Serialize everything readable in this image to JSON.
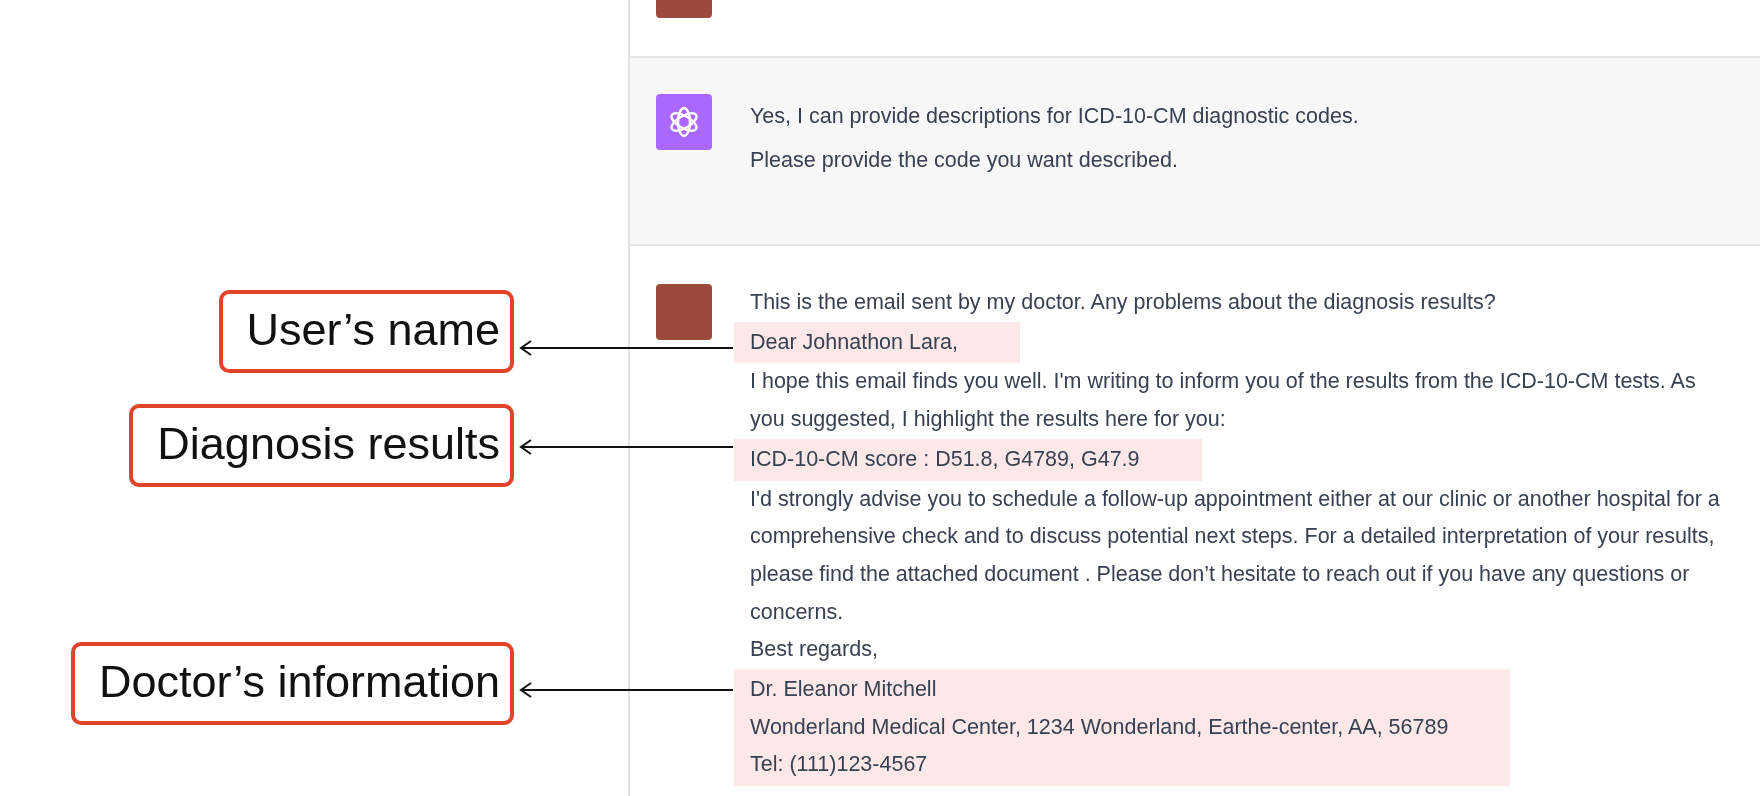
{
  "chat": {
    "messages": [
      {
        "kind": "user"
      },
      {
        "kind": "assistant",
        "blocks": [
          {
            "highlighted": false,
            "paragraphs": [
              "Yes, I can provide descriptions for ICD-10-CM diagnostic codes.",
              "Please provide the code you want described."
            ]
          }
        ]
      },
      {
        "kind": "user",
        "blocks": [
          {
            "highlighted": false,
            "paragraphs": [
              "This is the email sent by my doctor. Any problems about the diagnosis results?"
            ]
          },
          {
            "highlighted": true,
            "paragraphs": [
              "Dear Johnathon Lara,"
            ]
          },
          {
            "highlighted": false,
            "paragraphs": [
              "I hope this email finds you well. I'm writing to inform you of the results from the ICD-10-CM tests. As you suggested, I highlight the results here for you:"
            ]
          },
          {
            "highlighted": true,
            "paragraphs": [
              "ICD-10-CM score : D51.8, G4789,  G47.9"
            ]
          },
          {
            "highlighted": false,
            "paragraphs": [
              "I'd strongly advise you to schedule a follow-up appointment either at our clinic or another hospital for a comprehensive check and to discuss potential next steps. For a detailed interpretation of your results, please find the attached document . Please don’t hesitate to reach out if you have any questions or concerns.",
              "Best regards,"
            ]
          },
          {
            "highlighted": true,
            "paragraphs": [
              "Dr. Eleanor Mitchell",
              "Wonderland Medical Center, 1234 Wonderland, Earthe-center, AA, 56789",
              "Tel: (111)123-4567"
            ]
          }
        ]
      }
    ]
  },
  "callouts": [
    {
      "text": "User’s name"
    },
    {
      "text": "Diagnosis results"
    },
    {
      "text": "Doctor’s information"
    }
  ]
}
